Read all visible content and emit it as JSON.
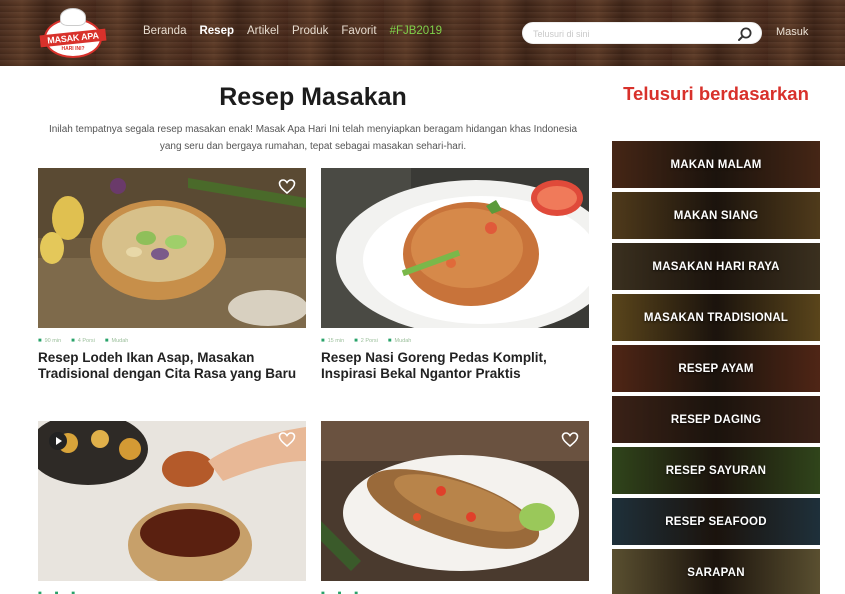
{
  "header": {
    "logo_text": "MASAK APA",
    "logo_sub": "HARI INI?",
    "nav": [
      "Beranda",
      "Resep",
      "Artikel",
      "Produk",
      "Favorit",
      "#FJB2019"
    ],
    "search_placeholder": "Telusuri di sini",
    "login": "Masuk"
  },
  "main": {
    "title": "Resep Masakan",
    "intro": "Inilah tempatnya segala resep masakan enak! Masak Apa Hari Ini telah menyiapkan beragam hidangan khas Indonesia yang seru dan bergaya rumahan, tepat sebagai masakan sehari-hari.",
    "recipes": [
      {
        "title": "Resep Lodeh Ikan Asap, Masakan Tradisional dengan Cita Rasa yang Baru",
        "meta": [
          "90 min",
          "4 Porsi",
          "Mudah"
        ]
      },
      {
        "title": "Resep Nasi Goreng Pedas Komplit, Inspirasi Bekal Ngantor Praktis",
        "meta": [
          "15 min",
          "2 Porsi",
          "Mudah"
        ]
      },
      {
        "title": "",
        "meta": [
          "",
          "",
          ""
        ]
      },
      {
        "title": "",
        "meta": [
          "",
          "",
          ""
        ]
      }
    ]
  },
  "sidebar": {
    "title": "Telusuri berdasarkan",
    "items": [
      {
        "label": "MAKAN MALAM",
        "color": "#6b3b22"
      },
      {
        "label": "MAKAN SIANG",
        "color": "#7a5a2a"
      },
      {
        "label": "MASAKAN HARI RAYA",
        "color": "#5a4a30"
      },
      {
        "label": "MASAKAN TRADISIONAL",
        "color": "#8a6a2a"
      },
      {
        "label": "RESEP AYAM",
        "color": "#7a3a22"
      },
      {
        "label": "RESEP DAGING",
        "color": "#5a3424"
      },
      {
        "label": "RESEP SAYURAN",
        "color": "#4a6a2a"
      },
      {
        "label": "RESEP SEAFOOD",
        "color": "#2f4a5a"
      },
      {
        "label": "SARAPAN",
        "color": "#8a7a4a"
      }
    ]
  },
  "colors": {
    "brand_red": "#d8312b",
    "hashtag_green": "#7fd14a",
    "meta_green": "#29a36a"
  }
}
